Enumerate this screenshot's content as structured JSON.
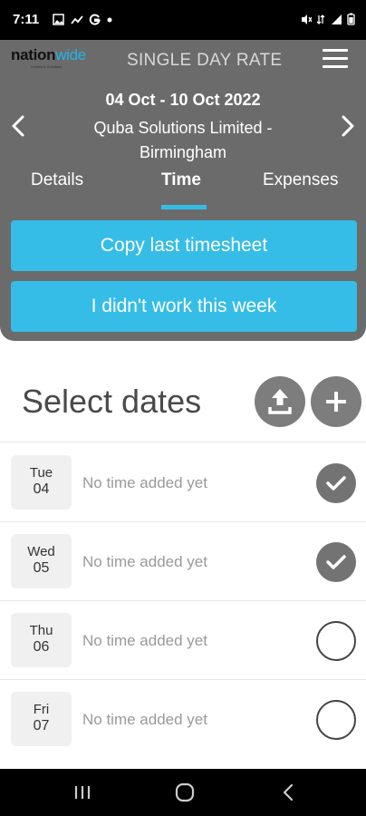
{
  "status_bar": {
    "time": "7:11",
    "left_icons": [
      "gallery-icon",
      "trend-icon",
      "google-icon",
      "dot-icon"
    ],
    "right_icons": [
      "mute-icon",
      "data-icon",
      "signal-icon",
      "battery-icon"
    ]
  },
  "header": {
    "logo_text_main": "nation",
    "logo_text_accent": "wide",
    "logo_subtext": "Limited & Solutions",
    "title": "SINGLE DAY RATE",
    "date_range": "04 Oct - 10 Oct 2022",
    "client_line1": "Quba Solutions Limited -",
    "client_line2": "Birmingham",
    "accent_color": "#35bde8"
  },
  "tabs": [
    {
      "label": "Details",
      "active": false
    },
    {
      "label": "Time",
      "active": true
    },
    {
      "label": "Expenses",
      "active": false
    }
  ],
  "actions": {
    "copy_label": "Copy last timesheet",
    "no_work_label": "I didn't work this week"
  },
  "select_dates": {
    "title": "Select dates"
  },
  "days": [
    {
      "day": "Tue",
      "date": "04",
      "status": "No time added yet",
      "selected": true
    },
    {
      "day": "Wed",
      "date": "05",
      "status": "No time added yet",
      "selected": true
    },
    {
      "day": "Thu",
      "date": "06",
      "status": "No time added yet",
      "selected": false
    },
    {
      "day": "Fri",
      "date": "07",
      "status": "No time added yet",
      "selected": false
    }
  ]
}
